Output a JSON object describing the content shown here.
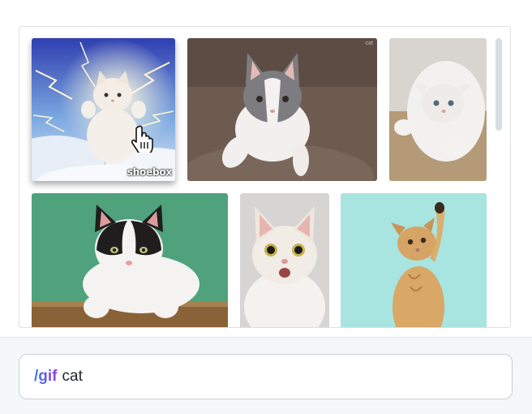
{
  "gif_results": {
    "items": [
      {
        "id": "cat-lightning",
        "watermark": "shoebox"
      },
      {
        "id": "cat-gray-white-walking",
        "corner_mark": "cat"
      },
      {
        "id": "cat-white-rolling"
      },
      {
        "id": "cat-tuxedo-on-ledge"
      },
      {
        "id": "cat-surprised-white"
      },
      {
        "id": "cat-tabby-reaching"
      }
    ],
    "hovered_index": 0
  },
  "composer": {
    "command": "/gif",
    "query": "cat"
  },
  "colors": {
    "command_gradient_start": "#3f7be6",
    "command_gradient_end": "#8b3fe0",
    "panel_border": "#dcdfe4",
    "composer_background": "#f6f7f9"
  },
  "icons": {
    "cursor": "hand-pointer-icon"
  }
}
